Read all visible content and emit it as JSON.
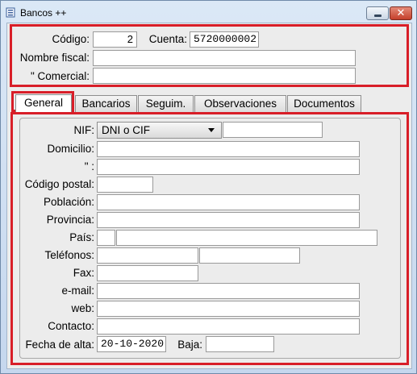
{
  "window": {
    "title": "Bancos  ++",
    "close_glyph": "✕",
    "icons": [
      "app-icon",
      "minimize-icon",
      "close-icon"
    ]
  },
  "header": {
    "codigo_label": "Código:",
    "codigo_value": "2",
    "cuenta_label": "Cuenta:",
    "cuenta_value": "5720000002",
    "nombre_fiscal_label": "Nombre fiscal:",
    "nombre_fiscal_value": "",
    "comercial_label": "\"  Comercial:",
    "comercial_value": ""
  },
  "tabs": [
    "General",
    "Bancarios",
    "Seguim.",
    "Observaciones",
    "Documentos"
  ],
  "active_tab": "General",
  "general": {
    "nif_label": "NIF:",
    "nif_type": "DNI o CIF",
    "nif_value": "",
    "domicilio_label": "Domicilio:",
    "domicilio_value": "",
    "domicilio2_label": "\" :",
    "domicilio2_value": "",
    "codigo_postal_label": "Código postal:",
    "codigo_postal_value": "",
    "poblacion_label": "Población:",
    "poblacion_value": "",
    "provincia_label": "Provincia:",
    "provincia_value": "",
    "pais_label": "País:",
    "pais_code": "",
    "pais_value": "",
    "telefonos_label": "Teléfonos:",
    "telefono1": "",
    "telefono2": "",
    "fax_label": "Fax:",
    "fax_value": "",
    "email_label": "e-mail:",
    "email_value": "",
    "web_label": "web:",
    "web_value": "",
    "contacto_label": "Contacto:",
    "contacto_value": "",
    "fecha_alta_label": "Fecha de alta:",
    "fecha_alta_value": "20-10-2020",
    "baja_label": "Baja:",
    "baja_value": ""
  },
  "colors": {
    "highlight": "#d81e28",
    "title_bar": "#c5d7ee",
    "close_button": "#c5402b",
    "client_bg": "#ececec"
  }
}
